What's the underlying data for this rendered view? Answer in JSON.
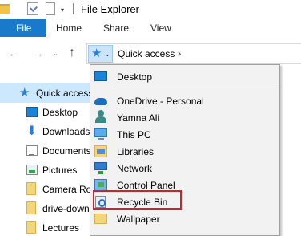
{
  "window": {
    "title": "File Explorer"
  },
  "quick_access_toolbar": {
    "dropdown_glyph": "▾"
  },
  "ribbon": {
    "tabs": [
      "File",
      "Home",
      "Share",
      "View"
    ]
  },
  "address_bar": {
    "back_glyph": "←",
    "forward_glyph": "→",
    "recent_glyph": "⌄",
    "up_glyph": "↑",
    "location_icon": "quick-access-star-icon",
    "location": "Quick access",
    "separator": "›",
    "chevron": "⌄"
  },
  "nav_pane": {
    "items": [
      {
        "label": "Quick access",
        "icon": "quick-access-star-icon",
        "selected": true
      },
      {
        "label": "Desktop",
        "icon": "desktop-icon"
      },
      {
        "label": "Downloads",
        "icon": "downloads-icon"
      },
      {
        "label": "Documents",
        "icon": "documents-icon"
      },
      {
        "label": "Pictures",
        "icon": "pictures-icon"
      },
      {
        "label": "Camera Roll",
        "icon": "folder-icon"
      },
      {
        "label": "drive-download",
        "icon": "folder-icon"
      },
      {
        "label": "Lectures",
        "icon": "folder-icon"
      }
    ]
  },
  "location_menu": {
    "items": [
      {
        "label": "Desktop",
        "icon": "desktop-icon"
      },
      {
        "label": "OneDrive - Personal",
        "icon": "onedrive-cloud-icon"
      },
      {
        "label": "Yamna Ali",
        "icon": "user-icon"
      },
      {
        "label": "This PC",
        "icon": "this-pc-icon"
      },
      {
        "label": "Libraries",
        "icon": "libraries-icon"
      },
      {
        "label": "Network",
        "icon": "network-icon"
      },
      {
        "label": "Control Panel",
        "icon": "control-panel-icon"
      },
      {
        "label": "Recycle Bin",
        "icon": "recycle-bin-icon",
        "highlighted": true
      },
      {
        "label": "Wallpaper",
        "icon": "folder-icon"
      }
    ],
    "highlight_color": "#c8262e"
  },
  "colors": {
    "file_tab": "#1979ca",
    "selection": "#cce8ff",
    "accent_blue": "#2a7fd4"
  }
}
